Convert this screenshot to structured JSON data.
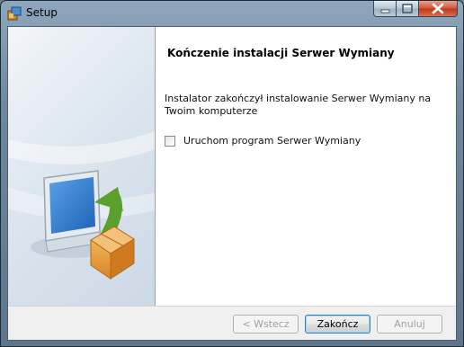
{
  "window": {
    "title": "Setup"
  },
  "caption_buttons": {
    "minimize_icon": "minimize-icon",
    "maximize_icon": "maximize-icon",
    "close_icon": "close-icon"
  },
  "wizard": {
    "heading": "Kończenie instalacji Serwer Wymiany",
    "message": "Instalator zakończył instalowanie Serwer Wymiany na Twoim komputerze",
    "launch_checkbox": {
      "label": "Uruchom program Serwer Wymiany",
      "checked": false
    }
  },
  "buttons": {
    "back": "< Wstecz",
    "finish": "Zakończ",
    "cancel": "Anuluj"
  },
  "colors": {
    "accent": "#3c7fb1",
    "close_button": "#c0381b",
    "box": "#e79a3c",
    "arrow": "#5aa02c"
  }
}
